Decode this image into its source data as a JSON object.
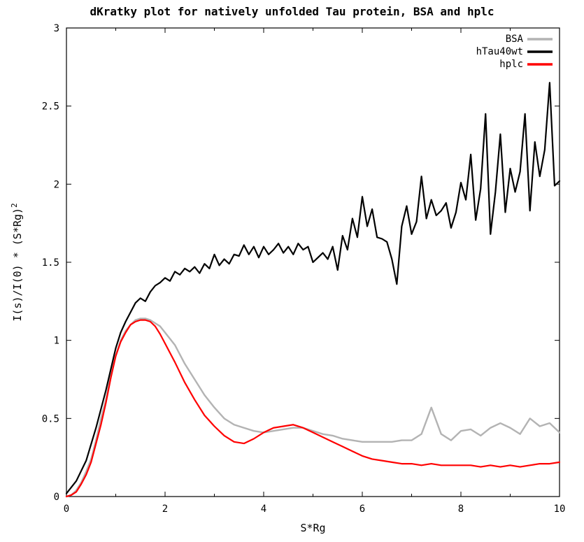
{
  "chart_data": {
    "type": "line",
    "title": "dKratky plot for natively unfolded Tau protein, BSA and hplc",
    "xlabel": "S*Rg",
    "ylabel": "I(s)/I(0) * (S*Rg)²",
    "xlim": [
      0,
      10
    ],
    "ylim": [
      0,
      3
    ],
    "x_ticks": [
      0,
      2,
      4,
      6,
      8,
      10
    ],
    "y_ticks": [
      0,
      0.5,
      1,
      1.5,
      2,
      2.5,
      3
    ],
    "legend_position": "top-right",
    "series": [
      {
        "name": "BSA",
        "color": "#b3b3b3",
        "x": [
          0,
          0.1,
          0.2,
          0.3,
          0.4,
          0.5,
          0.6,
          0.7,
          0.8,
          0.9,
          1.0,
          1.1,
          1.2,
          1.3,
          1.4,
          1.5,
          1.6,
          1.7,
          1.8,
          1.9,
          2.0,
          2.2,
          2.4,
          2.6,
          2.8,
          3.0,
          3.2,
          3.4,
          3.6,
          3.8,
          4.0,
          4.2,
          4.4,
          4.6,
          4.8,
          5.0,
          5.2,
          5.4,
          5.6,
          5.8,
          6.0,
          6.2,
          6.4,
          6.6,
          6.8,
          7.0,
          7.2,
          7.4,
          7.6,
          7.8,
          8.0,
          8.2,
          8.4,
          8.6,
          8.8,
          9.0,
          9.2,
          9.4,
          9.6,
          9.8,
          10.0
        ],
        "values": [
          0.0,
          0.01,
          0.04,
          0.09,
          0.16,
          0.24,
          0.36,
          0.5,
          0.62,
          0.78,
          0.9,
          1.0,
          1.06,
          1.1,
          1.13,
          1.14,
          1.14,
          1.13,
          1.11,
          1.09,
          1.05,
          0.97,
          0.85,
          0.75,
          0.65,
          0.57,
          0.5,
          0.46,
          0.44,
          0.42,
          0.41,
          0.42,
          0.43,
          0.44,
          0.44,
          0.42,
          0.4,
          0.39,
          0.37,
          0.36,
          0.35,
          0.35,
          0.35,
          0.35,
          0.36,
          0.36,
          0.4,
          0.57,
          0.4,
          0.36,
          0.42,
          0.43,
          0.39,
          0.44,
          0.47,
          0.44,
          0.4,
          0.5,
          0.45,
          0.47,
          0.41
        ]
      },
      {
        "name": "hTau40wt",
        "color": "#000000",
        "x": [
          0,
          0.2,
          0.4,
          0.6,
          0.8,
          1.0,
          1.1,
          1.2,
          1.3,
          1.4,
          1.5,
          1.6,
          1.7,
          1.8,
          1.9,
          2.0,
          2.1,
          2.2,
          2.3,
          2.4,
          2.5,
          2.6,
          2.7,
          2.8,
          2.9,
          3.0,
          3.1,
          3.2,
          3.3,
          3.4,
          3.5,
          3.6,
          3.7,
          3.8,
          3.9,
          4.0,
          4.1,
          4.2,
          4.3,
          4.4,
          4.5,
          4.6,
          4.7,
          4.8,
          4.9,
          5.0,
          5.1,
          5.2,
          5.3,
          5.4,
          5.5,
          5.6,
          5.7,
          5.8,
          5.9,
          6.0,
          6.1,
          6.2,
          6.3,
          6.4,
          6.5,
          6.6,
          6.7,
          6.8,
          6.9,
          7.0,
          7.1,
          7.2,
          7.3,
          7.4,
          7.5,
          7.6,
          7.7,
          7.8,
          7.9,
          8.0,
          8.1,
          8.2,
          8.3,
          8.4,
          8.5,
          8.6,
          8.7,
          8.8,
          8.9,
          9.0,
          9.1,
          9.2,
          9.3,
          9.4,
          9.5,
          9.6,
          9.7,
          9.8,
          9.9,
          10.0
        ],
        "values": [
          0.02,
          0.1,
          0.23,
          0.44,
          0.68,
          0.95,
          1.05,
          1.12,
          1.18,
          1.24,
          1.27,
          1.25,
          1.31,
          1.35,
          1.37,
          1.4,
          1.38,
          1.44,
          1.42,
          1.46,
          1.44,
          1.47,
          1.43,
          1.49,
          1.46,
          1.55,
          1.48,
          1.52,
          1.49,
          1.55,
          1.54,
          1.61,
          1.55,
          1.6,
          1.53,
          1.6,
          1.55,
          1.58,
          1.62,
          1.56,
          1.6,
          1.55,
          1.62,
          1.58,
          1.6,
          1.5,
          1.53,
          1.56,
          1.52,
          1.6,
          1.45,
          1.67,
          1.58,
          1.78,
          1.66,
          1.92,
          1.73,
          1.84,
          1.66,
          1.65,
          1.63,
          1.52,
          1.36,
          1.73,
          1.86,
          1.68,
          1.76,
          2.05,
          1.78,
          1.9,
          1.8,
          1.83,
          1.88,
          1.72,
          1.82,
          2.01,
          1.9,
          2.19,
          1.77,
          1.97,
          2.45,
          1.68,
          1.95,
          2.32,
          1.82,
          2.1,
          1.95,
          2.08,
          2.45,
          1.83,
          2.27,
          2.05,
          2.22,
          2.65,
          1.99,
          2.02
        ]
      },
      {
        "name": "hplc",
        "color": "#ff0000",
        "x": [
          0,
          0.1,
          0.2,
          0.3,
          0.4,
          0.5,
          0.6,
          0.7,
          0.8,
          0.9,
          1.0,
          1.1,
          1.2,
          1.3,
          1.4,
          1.5,
          1.6,
          1.7,
          1.8,
          1.9,
          2.0,
          2.2,
          2.4,
          2.6,
          2.8,
          3.0,
          3.2,
          3.4,
          3.6,
          3.8,
          4.0,
          4.2,
          4.4,
          4.6,
          4.8,
          5.0,
          5.2,
          5.4,
          5.6,
          5.8,
          6.0,
          6.2,
          6.4,
          6.6,
          6.8,
          7.0,
          7.2,
          7.4,
          7.6,
          7.8,
          8.0,
          8.2,
          8.4,
          8.6,
          8.8,
          9.0,
          9.2,
          9.4,
          9.6,
          9.8,
          10.0
        ],
        "values": [
          0.0,
          0.01,
          0.03,
          0.08,
          0.14,
          0.22,
          0.34,
          0.46,
          0.6,
          0.76,
          0.9,
          0.99,
          1.05,
          1.1,
          1.12,
          1.13,
          1.13,
          1.12,
          1.09,
          1.04,
          0.98,
          0.86,
          0.73,
          0.62,
          0.52,
          0.45,
          0.39,
          0.35,
          0.34,
          0.37,
          0.41,
          0.44,
          0.45,
          0.46,
          0.44,
          0.41,
          0.38,
          0.35,
          0.32,
          0.29,
          0.26,
          0.24,
          0.23,
          0.22,
          0.21,
          0.21,
          0.2,
          0.21,
          0.2,
          0.2,
          0.2,
          0.2,
          0.19,
          0.2,
          0.19,
          0.2,
          0.19,
          0.2,
          0.21,
          0.21,
          0.22
        ]
      }
    ]
  }
}
